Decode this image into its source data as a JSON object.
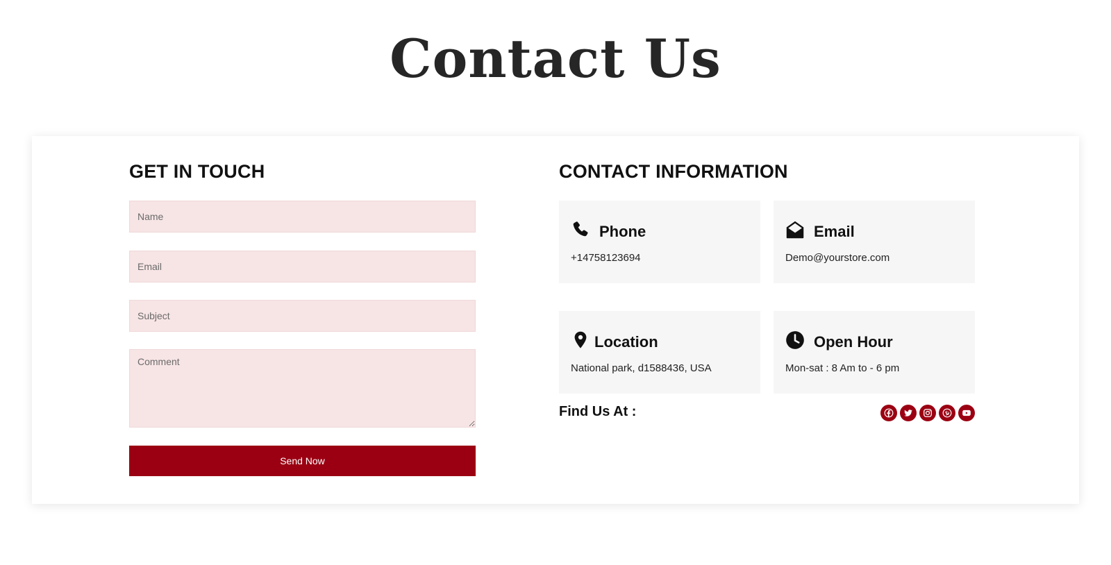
{
  "page": {
    "title": "Contact Us"
  },
  "form": {
    "heading": "GET IN TOUCH",
    "name_placeholder": "Name",
    "email_placeholder": "Email",
    "subject_placeholder": "Subject",
    "comment_placeholder": "Comment",
    "submit_label": "Send Now"
  },
  "contact": {
    "heading": "CONTACT INFORMATION",
    "items": [
      {
        "title": "Phone",
        "value": "+14758123694",
        "icon": "phone-icon"
      },
      {
        "title": "Email",
        "value": "Demo@yourstore.com",
        "icon": "envelope-open-icon"
      },
      {
        "title": "Location",
        "value": "National park, d1588436, USA",
        "icon": "map-pin-icon"
      },
      {
        "title": "Open Hour",
        "value": "Mon-sat : 8 Am to - 6 pm",
        "icon": "clock-icon"
      }
    ],
    "find_us_label": "Find Us At :",
    "social": [
      "facebook-icon",
      "twitter-icon",
      "instagram-icon",
      "pinterest-icon",
      "youtube-icon"
    ]
  },
  "colors": {
    "accent": "#9b0012",
    "field_bg": "#f7e4e5",
    "info_box_bg": "#f6f6f6",
    "title_text": "#262626"
  }
}
